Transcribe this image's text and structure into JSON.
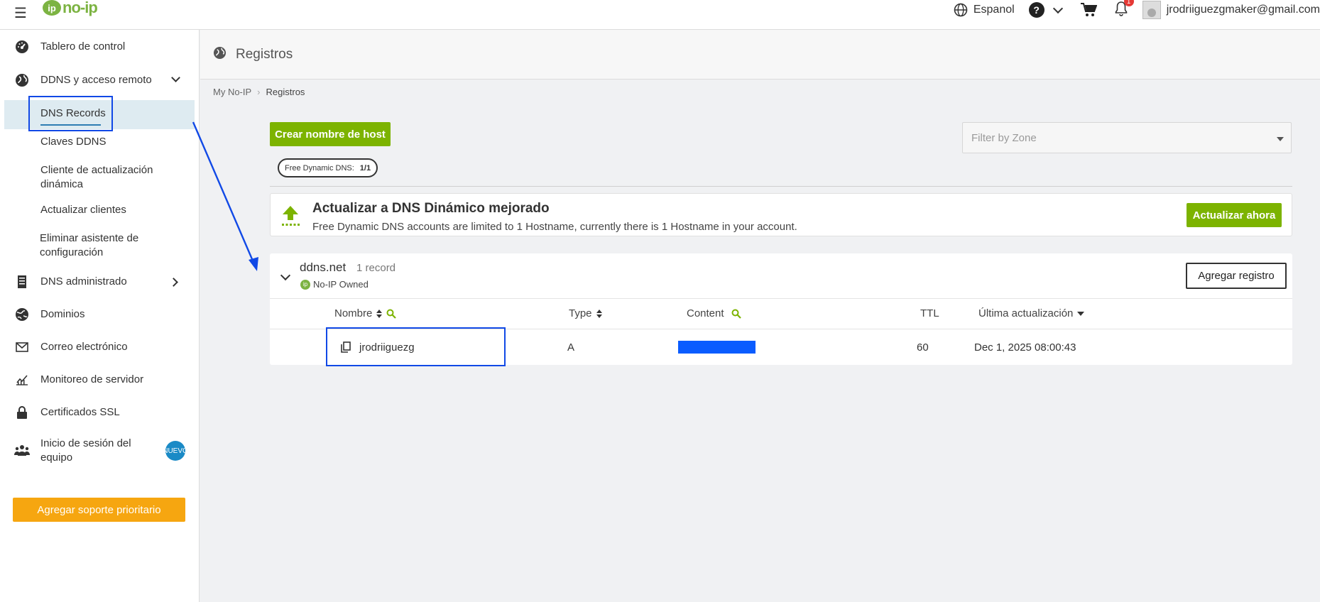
{
  "topbar": {
    "logo_text": "no-ip",
    "language": "Espanol",
    "help": "?",
    "notification_count": "1",
    "user_email": "jrodriiguezgmaker@gmail.com"
  },
  "sidebar": {
    "items": [
      {
        "label": "Tablero de control",
        "icon": "dashboard-icon"
      },
      {
        "label": "DDNS y acceso remoto",
        "icon": "globe-icon"
      },
      {
        "label": "DNS administrado",
        "icon": "server-icon"
      },
      {
        "label": "Dominios",
        "icon": "domains-globe-icon"
      },
      {
        "label": "Correo electrónico",
        "icon": "mail-icon"
      },
      {
        "label": "Monitoreo de servidor",
        "icon": "chart-icon"
      },
      {
        "label": "Certificados SSL",
        "icon": "lock-icon"
      },
      {
        "label": "Inicio de sesión del equipo",
        "icon": "team-icon"
      }
    ],
    "subitems": [
      {
        "label": "DNS Records",
        "active": true
      },
      {
        "label": "Claves DDNS"
      },
      {
        "label": "Cliente de actualización dinámica"
      },
      {
        "label": "Actualizar clientes"
      },
      {
        "label": "Eliminar asistente de configuración"
      }
    ],
    "team_badge": "NUEVO",
    "priority_button": "Agregar soporte prioritario"
  },
  "page": {
    "title": "Registros",
    "breadcrumb": [
      "My No-IP",
      "Registros"
    ]
  },
  "main": {
    "create_button": "Crear nombre de host",
    "filter_placeholder": "Filter by Zone",
    "plan_pill_label": "Free Dynamic DNS:",
    "plan_pill_value": "1/1",
    "upgrade": {
      "title": "Actualizar a DNS Dinámico mejorado",
      "text": "Free Dynamic DNS accounts are limited to 1 Hostname, currently there is 1 Hostname in your account.",
      "button": "Actualizar ahora"
    },
    "zone": {
      "name": "ddns.net",
      "count": "1 record",
      "owner": "No-IP Owned",
      "add_button": "Agregar registro",
      "columns": [
        "Nombre",
        "Type",
        "Content",
        "TTL",
        "Última actualización"
      ],
      "rows": [
        {
          "name": "jrodriiguezg",
          "type": "A",
          "content": "",
          "ttl": "60",
          "updated": "Dec 1, 2025 08:00:43"
        }
      ]
    }
  },
  "colors": {
    "green": "#7cb300",
    "orange": "#f6a610",
    "highlight_blue": "#1149e6",
    "active_bg": "#deebf1"
  }
}
